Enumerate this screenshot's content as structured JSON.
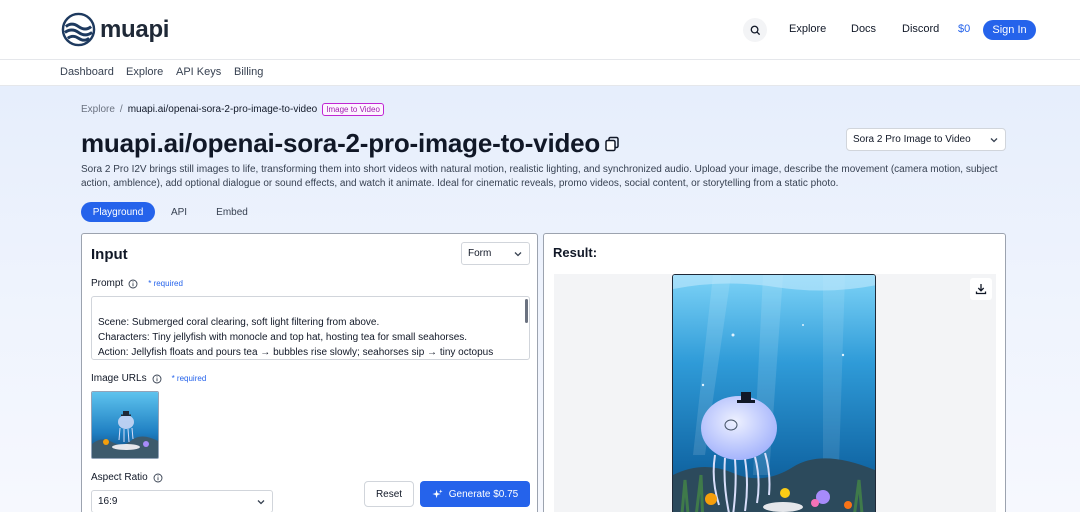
{
  "header": {
    "brand": "muapi",
    "nav": [
      "Explore",
      "Docs",
      "Discord"
    ],
    "balance": "$0",
    "signin_label": "Sign In",
    "search_icon": "search-icon"
  },
  "subnav": [
    "Dashboard",
    "Explore",
    "API Keys",
    "Billing"
  ],
  "breadcrumb": {
    "root": "Explore",
    "sep": "/",
    "current": "muapi.ai/openai-sora-2-pro-image-to-video",
    "badge": "Image to Video"
  },
  "page": {
    "title": "muapi.ai/openai-sora-2-pro-image-to-video",
    "model_select": "Sora 2 Pro Image to Video",
    "description": "Sora 2 Pro I2V brings still images to life, transforming them into short videos with natural motion, realistic lighting, and synchronized audio. Upload your image, describe the movement (camera motion, subject action, amblence), add optional dialogue or sound effects, and watch it animate. Ideal for cinematic reveals, promo videos, social content, or storytelling from a static photo."
  },
  "tabs": [
    "Playground",
    "API",
    "Embed"
  ],
  "input": {
    "title": "Input",
    "mode": "Form",
    "prompt_label": "Prompt",
    "required": "* required",
    "prompt_value": "Scene: Submerged coral clearing, soft light filtering from above.\nCharacters: Tiny jellyfish with monocle and top hat, hosting tea for small seahorses.\nAction: Jellyfish floats and pours tea → bubbles rise slowly; seahorses sip → tiny octopus clumsily serves cake.",
    "image_urls_label": "Image URLs",
    "aspect_label": "Aspect Ratio",
    "aspect_value": "16:9",
    "reset_label": "Reset",
    "generate_label": "Generate $0.75"
  },
  "result": {
    "title": "Result:"
  },
  "colors": {
    "accent": "#2563eb",
    "badge": "#c026d3"
  }
}
